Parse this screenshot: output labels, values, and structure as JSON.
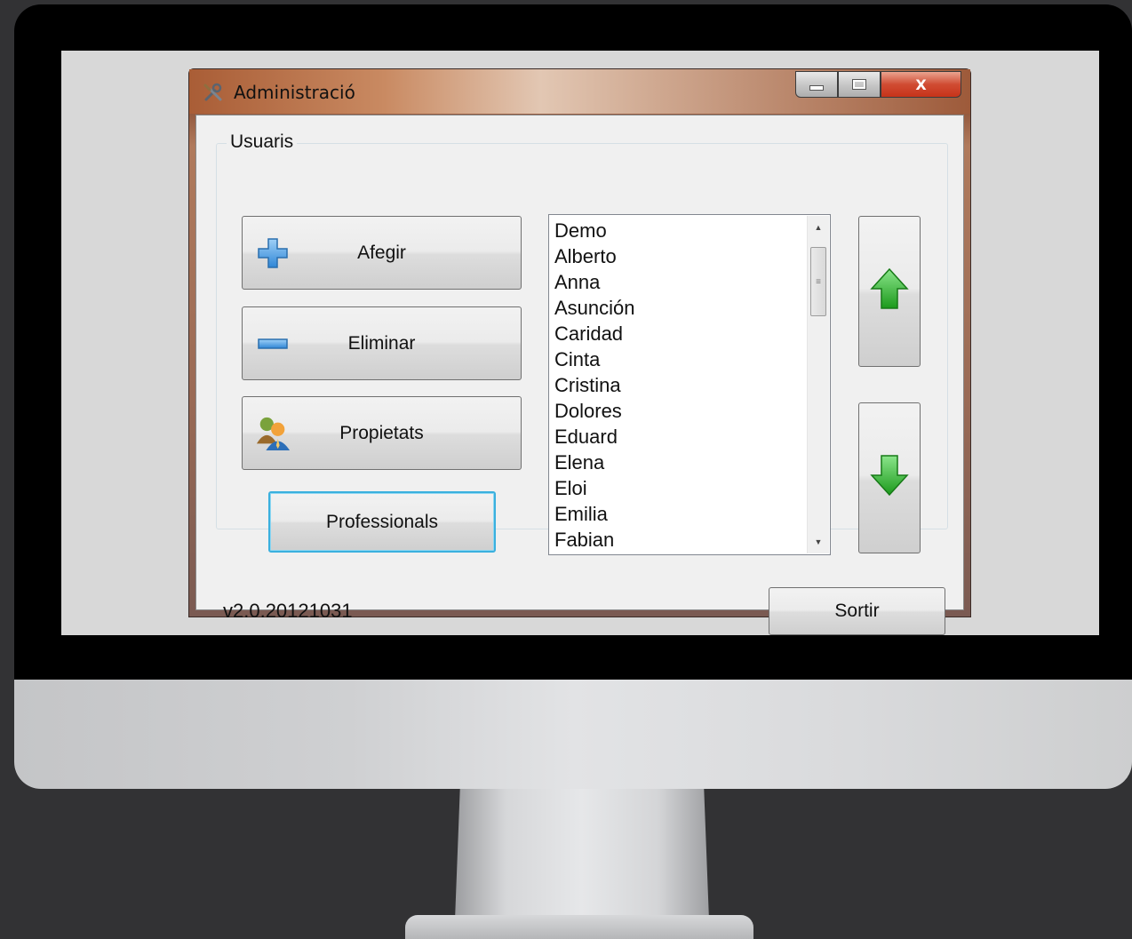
{
  "window": {
    "title": "Administració",
    "app_icon": "tools-icon",
    "caption": {
      "minimize": "minimize-icon",
      "maximize": "maximize-icon",
      "close_label": "X"
    }
  },
  "group": {
    "label": "Usuaris"
  },
  "buttons": {
    "afegir": {
      "label": "Afegir",
      "icon": "plus-icon"
    },
    "eliminar": {
      "label": "Eliminar",
      "icon": "minus-icon"
    },
    "propietats": {
      "label": "Propietats",
      "icon": "users-icon"
    },
    "professionals": {
      "label": "Professionals"
    },
    "move_up": {
      "icon": "arrow-up-icon"
    },
    "move_down": {
      "icon": "arrow-down-icon"
    },
    "sortir": {
      "label": "Sortir"
    }
  },
  "users": [
    "Demo",
    "Alberto",
    "Anna",
    "Asunción",
    "Caridad",
    "Cinta",
    "Cristina",
    "Dolores",
    "Eduard",
    "Elena",
    "Eloi",
    "Emilia",
    "Fabian"
  ],
  "footer": {
    "version": "v2.0.20121031"
  },
  "colors": {
    "accent_focus": "#3ab0de",
    "arrow_green": "#2fb52f",
    "close_red": "#c7331a",
    "plus_blue": "#4a9be0"
  }
}
